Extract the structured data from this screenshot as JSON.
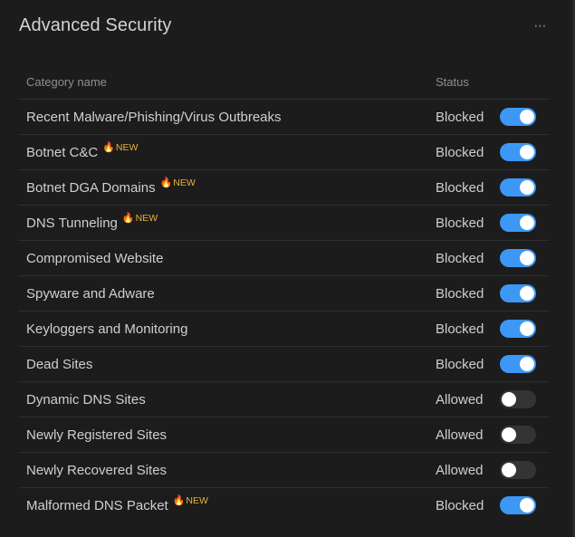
{
  "panel": {
    "title": "Advanced Security",
    "more_icon": "⋯"
  },
  "table": {
    "headers": {
      "name": "Category name",
      "status": "Status"
    },
    "badge": {
      "icon": "🔥",
      "label": "NEW"
    },
    "rows": [
      {
        "name": "Recent Malware/Phishing/Virus Outbreaks",
        "is_new": false,
        "status": "Blocked",
        "enabled": true
      },
      {
        "name": "Botnet C&C",
        "is_new": true,
        "status": "Blocked",
        "enabled": true
      },
      {
        "name": "Botnet DGA Domains",
        "is_new": true,
        "status": "Blocked",
        "enabled": true
      },
      {
        "name": "DNS Tunneling",
        "is_new": true,
        "status": "Blocked",
        "enabled": true
      },
      {
        "name": "Compromised Website",
        "is_new": false,
        "status": "Blocked",
        "enabled": true
      },
      {
        "name": "Spyware and Adware",
        "is_new": false,
        "status": "Blocked",
        "enabled": true
      },
      {
        "name": "Keyloggers and Monitoring",
        "is_new": false,
        "status": "Blocked",
        "enabled": true
      },
      {
        "name": "Dead Sites",
        "is_new": false,
        "status": "Blocked",
        "enabled": true
      },
      {
        "name": "Dynamic DNS Sites",
        "is_new": false,
        "status": "Allowed",
        "enabled": false
      },
      {
        "name": "Newly Registered Sites",
        "is_new": false,
        "status": "Allowed",
        "enabled": false
      },
      {
        "name": "Newly Recovered Sites",
        "is_new": false,
        "status": "Allowed",
        "enabled": false
      },
      {
        "name": "Malformed DNS Packet",
        "is_new": true,
        "status": "Blocked",
        "enabled": true
      }
    ]
  },
  "colors": {
    "toggle_on": "#3d97f5",
    "toggle_off": "#343436",
    "new_badge": "#e8b331"
  }
}
